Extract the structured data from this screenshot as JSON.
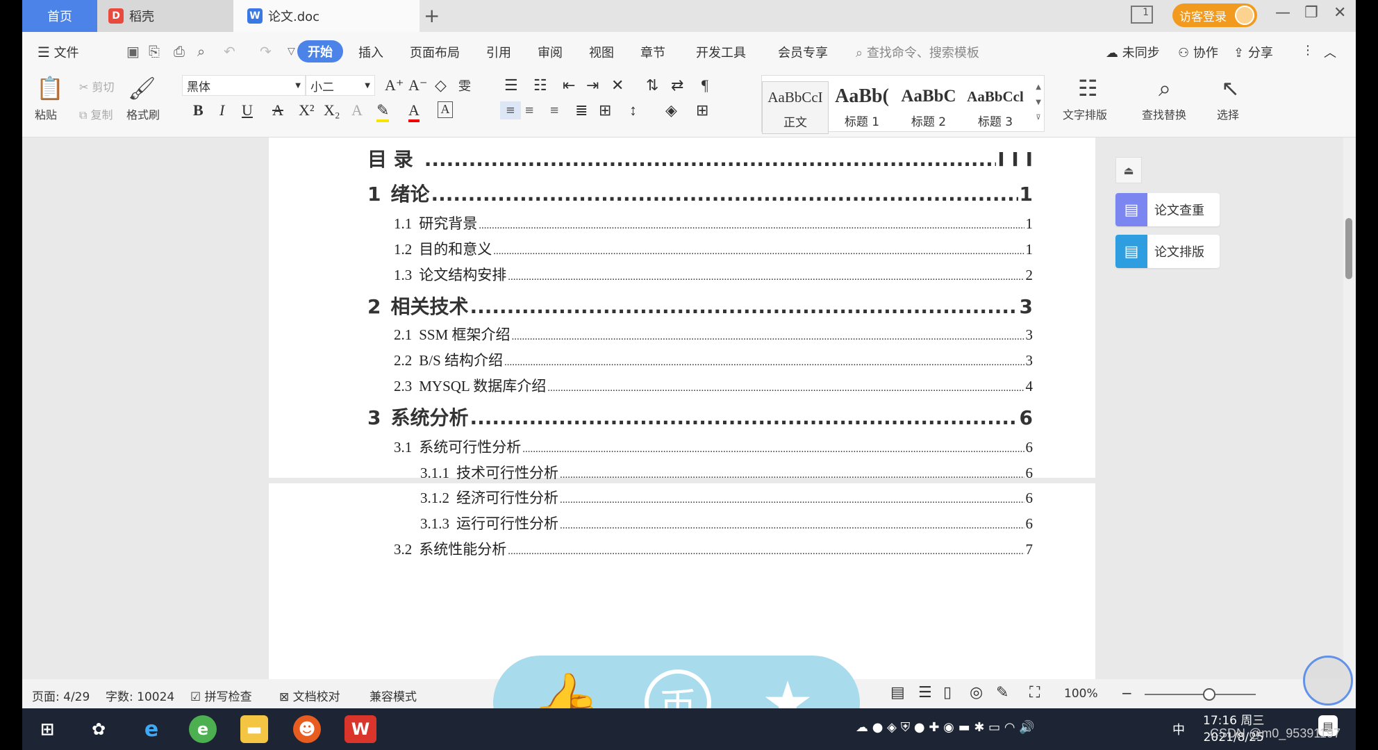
{
  "tabs": {
    "home": "首页",
    "docer": "稻壳",
    "doc": "论文.doc",
    "add": "+"
  },
  "titlebar": {
    "login": "访客登录",
    "min": "—",
    "restore": "❐",
    "close": "✕",
    "layout": "1"
  },
  "menu": {
    "file": "文件",
    "items": [
      "开始",
      "插入",
      "页面布局",
      "引用",
      "审阅",
      "视图",
      "章节",
      "开发工具",
      "会员专享"
    ],
    "search_placeholder": "查找命令、搜索模板",
    "unsync": "未同步",
    "collab": "协作",
    "share": "分享"
  },
  "ribbon": {
    "paste": "粘贴",
    "cut": "剪切",
    "copy": "复制",
    "format_painter": "格式刷",
    "font": "黑体",
    "font_size": "小二",
    "styles": [
      {
        "sample": "AaBbCcI",
        "label": "正文"
      },
      {
        "sample": "AaBb(",
        "label": "标题 1"
      },
      {
        "sample": "AaBbC",
        "label": "标题 2"
      },
      {
        "sample": "AaBbCcl",
        "label": "标题 3"
      }
    ],
    "text_layout": "文字排版",
    "find_replace": "查找替换",
    "select": "选择"
  },
  "toc": [
    {
      "num": "目  录",
      "title": "",
      "page": "I I I",
      "level": 0
    },
    {
      "num": "1",
      "title": "绪论",
      "page": "1",
      "level": 0
    },
    {
      "num": "1.1",
      "title": "研究背景",
      "page": "1",
      "level": 1
    },
    {
      "num": "1.2",
      "title": "目的和意义",
      "page": "1",
      "level": 1
    },
    {
      "num": "1.3",
      "title": "论文结构安排",
      "page": "2",
      "level": 1
    },
    {
      "num": "2",
      "title": "相关技术",
      "page": "3",
      "level": 0
    },
    {
      "num": "2.1",
      "title": "SSM 框架介绍",
      "page": "3",
      "level": 1
    },
    {
      "num": "2.2",
      "title": "B/S 结构介绍",
      "page": "3",
      "level": 1
    },
    {
      "num": "2.3",
      "title": "MYSQL 数据库介绍",
      "page": "4",
      "level": 1
    },
    {
      "num": "3",
      "title": "系统分析",
      "page": "6",
      "level": 0
    },
    {
      "num": "3.1",
      "title": "系统可行性分析",
      "page": "6",
      "level": 1
    },
    {
      "num": "3.1.1",
      "title": "技术可行性分析",
      "page": "6",
      "level": 2
    },
    {
      "num": "3.1.2",
      "title": "经济可行性分析",
      "page": "6",
      "level": 2
    },
    {
      "num": "3.1.3",
      "title": "运行可行性分析",
      "page": "6",
      "level": 2
    },
    {
      "num": "3.2",
      "title": "系统性能分析",
      "page": "7",
      "level": 1
    }
  ],
  "side_panel": {
    "check": "论文查重",
    "layout": "论文排版"
  },
  "status": {
    "page": "页面: 4/29",
    "words": "字数: 10024",
    "spell": "拼写检查",
    "proof": "文档校对",
    "compat": "兼容模式",
    "zoom": "100%"
  },
  "taskbar": {
    "time": "17:16 周三",
    "date": "2021/8/25",
    "ime": "中"
  },
  "watermark": "CSDN @m0_95391197",
  "colors": {
    "accent": "#4b83e8",
    "login": "#f29a1d",
    "overlay": "#a8dcec",
    "taskbar": "#1d2535"
  }
}
